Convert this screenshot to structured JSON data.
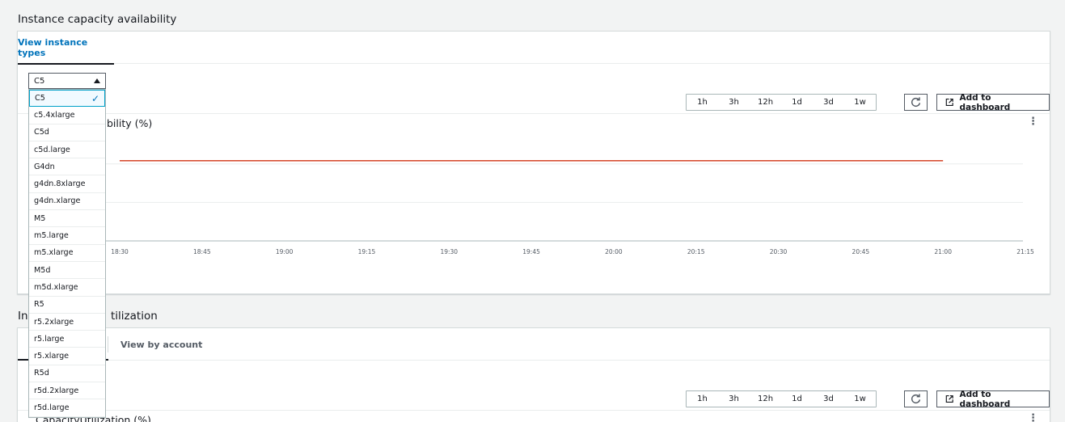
{
  "section1": {
    "title": "Instance capacity availability",
    "tabs": [
      {
        "label": "View instance types",
        "active": true
      }
    ],
    "time_ranges": [
      "1h",
      "3h",
      "12h",
      "1d",
      "3d",
      "1w"
    ],
    "add_dashboard_label": "Add to dashboard",
    "chart_title_visible": "bility (%)",
    "chart_data": {
      "type": "line",
      "title": "",
      "x": [
        "18:30",
        "18:45",
        "19:00",
        "19:15",
        "19:30",
        "19:45",
        "20:00",
        "20:15",
        "20:30",
        "20:45",
        "21:00",
        "21:15"
      ],
      "series": [
        {
          "values": [
            100,
            100,
            100,
            100,
            100,
            100,
            100,
            100,
            100,
            100,
            100
          ]
        }
      ],
      "line_color": "#d13212",
      "grid": true
    }
  },
  "section2": {
    "title_visible": "Ins",
    "title_rest": "tilization",
    "tabs": [
      {
        "label": "View by account",
        "active": false
      }
    ],
    "time_ranges": [
      "1h",
      "3h",
      "12h",
      "1d",
      "3d",
      "1w"
    ],
    "add_dashboard_label": "Add to dashboard",
    "chart_title_visible": "CapacityUtilization (%)"
  },
  "dropdown": {
    "selected": "C5",
    "options": [
      "C5",
      "c5.4xlarge",
      "C5d",
      "c5d.large",
      "G4dn",
      "g4dn.8xlarge",
      "g4dn.xlarge",
      "M5",
      "m5.large",
      "m5.xlarge",
      "M5d",
      "m5d.xlarge",
      "R5",
      "r5.2xlarge",
      "r5.large",
      "r5.xlarge",
      "R5d",
      "r5d.2xlarge",
      "r5d.large"
    ]
  },
  "colors": {
    "accent": "#0073bb",
    "series_line": "#d13212"
  },
  "icons": {
    "refresh": "refresh-icon",
    "external": "external-link-icon",
    "more": "more-vertical-icon",
    "check": "check-icon",
    "caret": "caret-up-icon"
  }
}
